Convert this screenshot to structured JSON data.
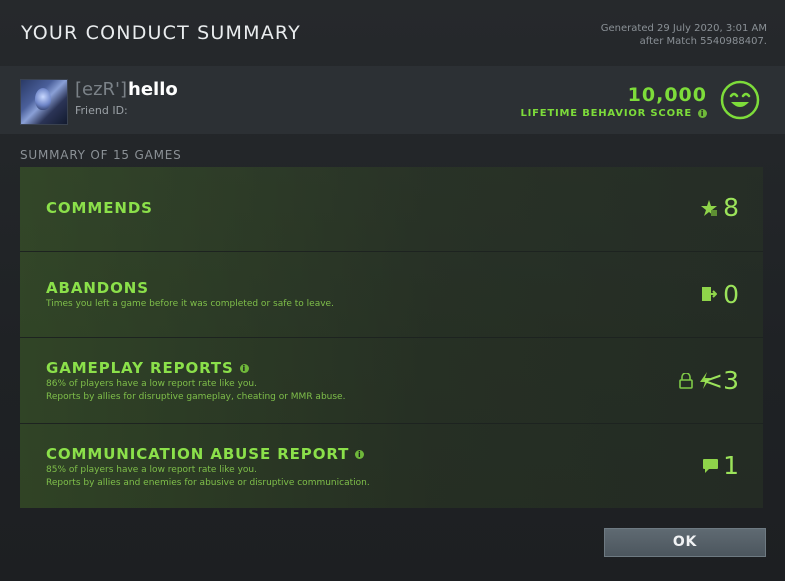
{
  "dialog": {
    "title": "YOUR CONDUCT SUMMARY",
    "generated_line1": "Generated 29 July 2020, 3:01 AM",
    "generated_line2": "after Match 5540988407."
  },
  "player": {
    "tag": "[ezR']",
    "name": "hello",
    "friend_id_label": "Friend ID:",
    "avatar_icon": "hero-portrait-avatar"
  },
  "behavior": {
    "score": "10,000",
    "label": "LIFETIME BEHAVIOR SCORE",
    "info_glyph": "i",
    "mood_icon": "smiley-face-icon",
    "accent": "#7ddc3a"
  },
  "summary": {
    "label": "SUMMARY OF 15 GAMES"
  },
  "rows": [
    {
      "title": "COMMENDS",
      "desc1": "",
      "desc2": "",
      "value": "8",
      "icon": "star-badge-icon"
    },
    {
      "title": "ABANDONS",
      "desc1": "Times you left a game before it was completed or safe to leave.",
      "desc2": "",
      "value": "0",
      "icon": "exit-door-icon"
    },
    {
      "title": "GAMEPLAY REPORTS",
      "desc1": "86% of players have a low report rate like you.",
      "desc2": "Reports by allies for disruptive gameplay, cheating or MMR abuse.",
      "value": "<3",
      "icon": "lock-lightning-icon"
    },
    {
      "title": "COMMUNICATION ABUSE REPORT",
      "desc1": "85% of players have a low report rate like you.",
      "desc2": "Reports by allies and enemies for abusive or disruptive communication.",
      "value": "1",
      "icon": "speech-bubble-icon"
    }
  ],
  "buttons": {
    "ok": "OK"
  }
}
